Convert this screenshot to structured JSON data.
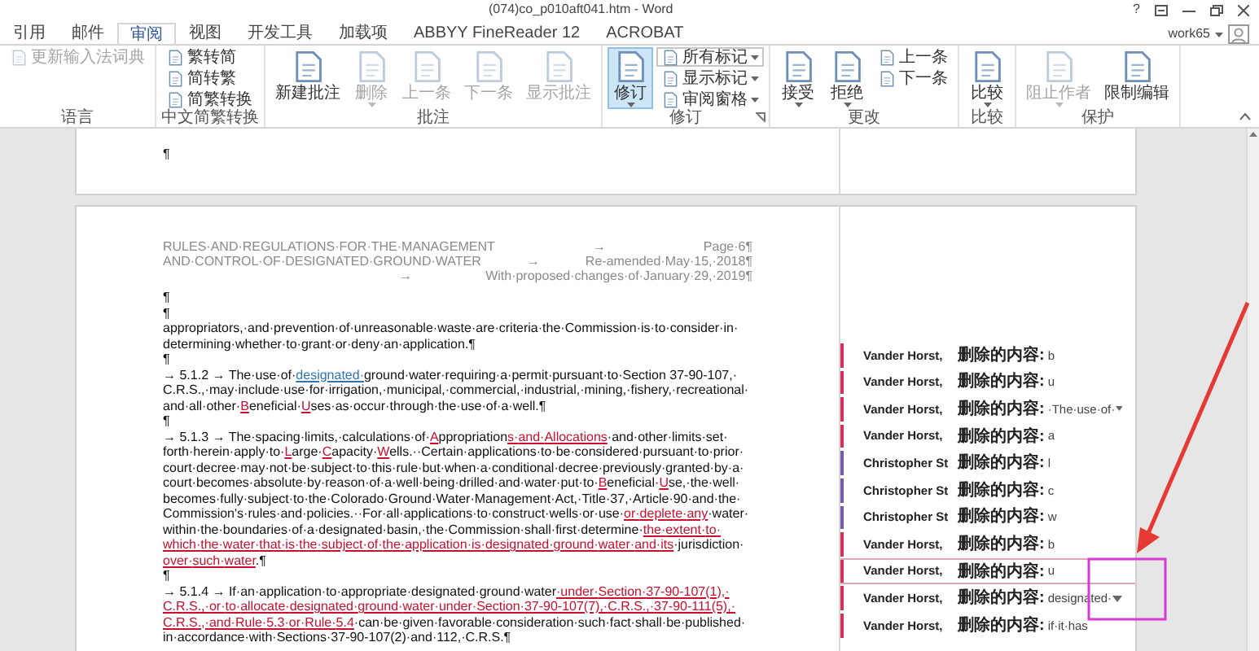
{
  "window": {
    "title": "(074)co_p010aft041.htm - Word",
    "help": "?"
  },
  "account": {
    "user": "work65"
  },
  "tabs": [
    {
      "label": "引用",
      "selected": false
    },
    {
      "label": "邮件",
      "selected": false
    },
    {
      "label": "审阅",
      "selected": true
    },
    {
      "label": "视图",
      "selected": false
    },
    {
      "label": "开发工具",
      "selected": false
    },
    {
      "label": "加载项",
      "selected": false
    },
    {
      "label": "ABBYY FineReader 12",
      "selected": false
    },
    {
      "label": "ACROBAT",
      "selected": false
    }
  ],
  "ribbon": {
    "groups": [
      {
        "label": "语言",
        "launcher": false,
        "items": [
          {
            "label": "更新输入法词典",
            "kind": "small",
            "disabled": true,
            "on": false,
            "menu": false
          }
        ]
      },
      {
        "label": "中文简繁转换",
        "launcher": false,
        "items": [
          {
            "label": "繁转简",
            "kind": "small",
            "disabled": false,
            "on": false,
            "menu": false
          },
          {
            "label": "简转繁",
            "kind": "small",
            "disabled": false,
            "on": false,
            "menu": false
          },
          {
            "label": "简繁转换",
            "kind": "small",
            "disabled": false,
            "on": false,
            "menu": false
          }
        ]
      },
      {
        "label": "批注",
        "launcher": false,
        "items": [
          {
            "label": "新建批注",
            "kind": "large",
            "disabled": false,
            "on": false,
            "menu": false
          },
          {
            "label": "删除",
            "kind": "large",
            "disabled": true,
            "on": false,
            "menu": true
          },
          {
            "label": "上一条",
            "kind": "large",
            "disabled": true,
            "on": false,
            "menu": false
          },
          {
            "label": "下一条",
            "kind": "large",
            "disabled": true,
            "on": false,
            "menu": false
          },
          {
            "label": "显示批注",
            "kind": "large",
            "disabled": true,
            "on": false,
            "menu": false
          }
        ]
      },
      {
        "label": "修订",
        "launcher": true,
        "items": [
          {
            "label": "修订",
            "kind": "large",
            "disabled": false,
            "on": true,
            "menu": true
          },
          {
            "label": "所有标记",
            "kind": "dropdown",
            "disabled": false,
            "on": false,
            "menu": true
          },
          {
            "label": "显示标记",
            "kind": "small",
            "disabled": false,
            "on": false,
            "menu": true
          },
          {
            "label": "审阅窗格",
            "kind": "small",
            "disabled": false,
            "on": false,
            "menu": true
          }
        ]
      },
      {
        "label": "更改",
        "launcher": false,
        "items": [
          {
            "label": "接受",
            "kind": "large",
            "disabled": false,
            "on": false,
            "menu": true
          },
          {
            "label": "拒绝",
            "kind": "large",
            "disabled": false,
            "on": false,
            "menu": true
          },
          {
            "label": "上一条",
            "kind": "small",
            "disabled": false,
            "on": false,
            "menu": false
          },
          {
            "label": "下一条",
            "kind": "small",
            "disabled": false,
            "on": false,
            "menu": false
          }
        ]
      },
      {
        "label": "比较",
        "launcher": false,
        "items": [
          {
            "label": "比较",
            "kind": "large",
            "disabled": false,
            "on": false,
            "menu": true
          }
        ]
      },
      {
        "label": "保护",
        "launcher": false,
        "items": [
          {
            "label": "阻止作者",
            "kind": "large",
            "disabled": true,
            "on": false,
            "menu": true
          },
          {
            "label": "限制编辑",
            "kind": "large",
            "disabled": false,
            "on": false,
            "menu": false
          }
        ]
      }
    ]
  },
  "document": {
    "previous_page": {
      "mark": "¶"
    },
    "header": [
      {
        "left": "RULES·AND·REGULATIONS·FOR·THE·MANAGEMENT",
        "tab": "→",
        "right": "Page·6¶"
      },
      {
        "left": "AND·CONTROL·OF·DESIGNATED·GROUND·WATER",
        "tab": "→",
        "right": "Re-amended·May·15,·2018¶"
      },
      {
        "tab": "→",
        "right": "With·proposed·changes·of·January·29,·2019¶"
      }
    ],
    "paragraphs": [
      {
        "runs": [
          {
            "text": "¶",
            "kind": "plain"
          }
        ]
      },
      {
        "runs": [
          {
            "text": "¶",
            "kind": "plain"
          }
        ]
      },
      {
        "runs": [
          {
            "text": "appropriators,·and·prevention·of·unreasonable·waste·are·criteria·the·Commission·is·to·consider·in·determining·whether·to·grant·or·deny·an·application.¶",
            "kind": "plain"
          }
        ]
      },
      {
        "runs": [
          {
            "text": "¶",
            "kind": "plain"
          }
        ]
      },
      {
        "runs": [
          {
            "text": "→ 5.1.2 → The·use·of·",
            "kind": "plain"
          },
          {
            "text": "designated·",
            "kind": "comment"
          },
          {
            "text": "ground·water·requiring·a·permit·pursuant·to·Section 37-90-107,·C.R.S.,·may·include·use·for·irrigation,·municipal,·commercial,·industrial,·mining,·fishery,·recreational·and·all·other·",
            "kind": "plain"
          },
          {
            "text": "B",
            "kind": "inserted"
          },
          {
            "text": "eneficial·",
            "kind": "plain"
          },
          {
            "text": "U",
            "kind": "inserted"
          },
          {
            "text": "ses·as·occur·through·the·use·of·a·well.¶",
            "kind": "plain"
          }
        ]
      },
      {
        "runs": [
          {
            "text": "¶",
            "kind": "plain"
          }
        ]
      },
      {
        "runs": [
          {
            "text": "→ 5.1.3 → The·spacing·limits,·calculations·of·",
            "kind": "plain"
          },
          {
            "text": "A",
            "kind": "inserted"
          },
          {
            "text": "ppropriation",
            "kind": "plain"
          },
          {
            "text": "s·and·Allocations",
            "kind": "inserted"
          },
          {
            "text": "·and·other·limits·set·",
            "kind": "plain"
          },
          {
            "text": "forth·herein·apply·to·",
            "kind": "plain"
          },
          {
            "text": "L",
            "kind": "inserted"
          },
          {
            "text": "arge·",
            "kind": "plain"
          },
          {
            "text": "C",
            "kind": "inserted"
          },
          {
            "text": "apacity·",
            "kind": "plain"
          },
          {
            "text": "W",
            "kind": "inserted"
          },
          {
            "text": "ells.··Certain·applications·to·be·considered·pursuant·to·prior·court·decree·may·not·be·subject·to·this·rule·but·when·a·conditional·decree·previously·granted·by·a·court·becomes·absolute·by·reason·of·a·well·being·drilled·and·water·put·to·",
            "kind": "plain"
          },
          {
            "text": "B",
            "kind": "inserted"
          },
          {
            "text": "eneficial·",
            "kind": "plain"
          },
          {
            "text": "U",
            "kind": "inserted"
          },
          {
            "text": "se,·the·well·becomes·fully·subject·to·the·Colorado·Ground·Water·Management·Act,·Title·37,·Article·90·and·the·Commission's·rules·and·policies.··For·all·applications·to·construct·wells·or·use·",
            "kind": "plain"
          },
          {
            "text": "or·deplete·any",
            "kind": "inserted"
          },
          {
            "text": "·water·within·the·boundaries·of·a·designated·basin,·the·Commission·shall·first·determine·",
            "kind": "plain"
          },
          {
            "text": "the·extent·to·which·the·water·that·is·the·subject·of·the·application·is·designated·ground·water·and·its",
            "kind": "inserted"
          },
          {
            "text": "·jurisdiction·",
            "kind": "plain"
          },
          {
            "text": "over·such·water",
            "kind": "inserted"
          },
          {
            "text": ".¶",
            "kind": "plain"
          }
        ]
      },
      {
        "runs": [
          {
            "text": "¶",
            "kind": "plain"
          }
        ]
      },
      {
        "runs": [
          {
            "text": "→ 5.1.4 → If·an·application·to·appropriate·designated·ground·water",
            "kind": "plain"
          },
          {
            "text": "·under·Section·37-90-107(1),·C.R.S.,·or·to·allocate·designated·ground·water·under·Section·37-90-107(7),·C.R.S.,·37-90-111(5),·C.R.S.,·and·Rule·5.3·or·Rule·5.4",
            "kind": "inserted"
          },
          {
            "text": "·can·be·given·favorable·consideration·such·fact·shall·be·published·in·accordance·with·Sections·37-90-107(2)·and·112,·C.R.S.¶",
            "kind": "plain"
          }
        ]
      }
    ]
  },
  "balloons": [
    {
      "author": "Vander Horst,",
      "label": "删除的内容:",
      "text": "b",
      "color": "#d4325a",
      "dropdown": false,
      "selected": false
    },
    {
      "author": "Vander Horst,",
      "label": "删除的内容:",
      "text": "u",
      "color": "#d4325a",
      "dropdown": false,
      "selected": false
    },
    {
      "author": "Vander Horst,",
      "label": "删除的内容:",
      "text": "·The·use·of·",
      "color": "#d4325a",
      "dropdown": true,
      "selected": false
    },
    {
      "author": "Vander Horst,",
      "label": "删除的内容:",
      "text": "a",
      "color": "#d4325a",
      "dropdown": false,
      "selected": false
    },
    {
      "author": "Christopher St",
      "label": "删除的内容:",
      "text": "l",
      "color": "#7a5aa8",
      "dropdown": false,
      "selected": false
    },
    {
      "author": "Christopher St",
      "label": "删除的内容:",
      "text": "c",
      "color": "#7a5aa8",
      "dropdown": false,
      "selected": false
    },
    {
      "author": "Christopher St",
      "label": "删除的内容:",
      "text": "w",
      "color": "#7a5aa8",
      "dropdown": false,
      "selected": false
    },
    {
      "author": "Vander Horst,",
      "label": "删除的内容:",
      "text": "b",
      "color": "#d4325a",
      "dropdown": false,
      "selected": false
    },
    {
      "author": "Vander Horst,",
      "label": "删除的内容:",
      "text": "u",
      "color": "#d4325a",
      "dropdown": false,
      "selected": true
    },
    {
      "author": "Vander Horst,",
      "label": "删除的内容:",
      "text": "designated·",
      "color": "#d4325a",
      "dropdown": true,
      "selected": false
    },
    {
      "author": "Vander Horst,",
      "label": "删除的内容:",
      "text": "if·it·has",
      "color": "#d4325a",
      "dropdown": false,
      "selected": false
    }
  ]
}
